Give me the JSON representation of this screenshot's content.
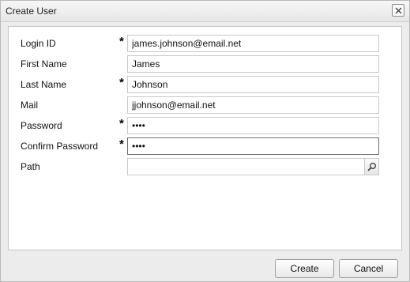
{
  "dialog": {
    "title": "Create User",
    "close_icon": "close-icon"
  },
  "form": {
    "login_id": {
      "label": "Login ID",
      "required": "*",
      "value": "james.johnson@email.net"
    },
    "first_name": {
      "label": "First Name",
      "value": "James"
    },
    "last_name": {
      "label": "Last Name",
      "required": "*",
      "value": "Johnson"
    },
    "mail": {
      "label": "Mail",
      "value": "jjohnson@email.net"
    },
    "password": {
      "label": "Password",
      "required": "*",
      "value": "••••"
    },
    "confirm_password": {
      "label": "Confirm Password",
      "required": "*",
      "value": "••••"
    },
    "path": {
      "label": "Path",
      "value": "",
      "browse_icon": "search-icon"
    }
  },
  "buttons": {
    "create": "Create",
    "cancel": "Cancel"
  }
}
